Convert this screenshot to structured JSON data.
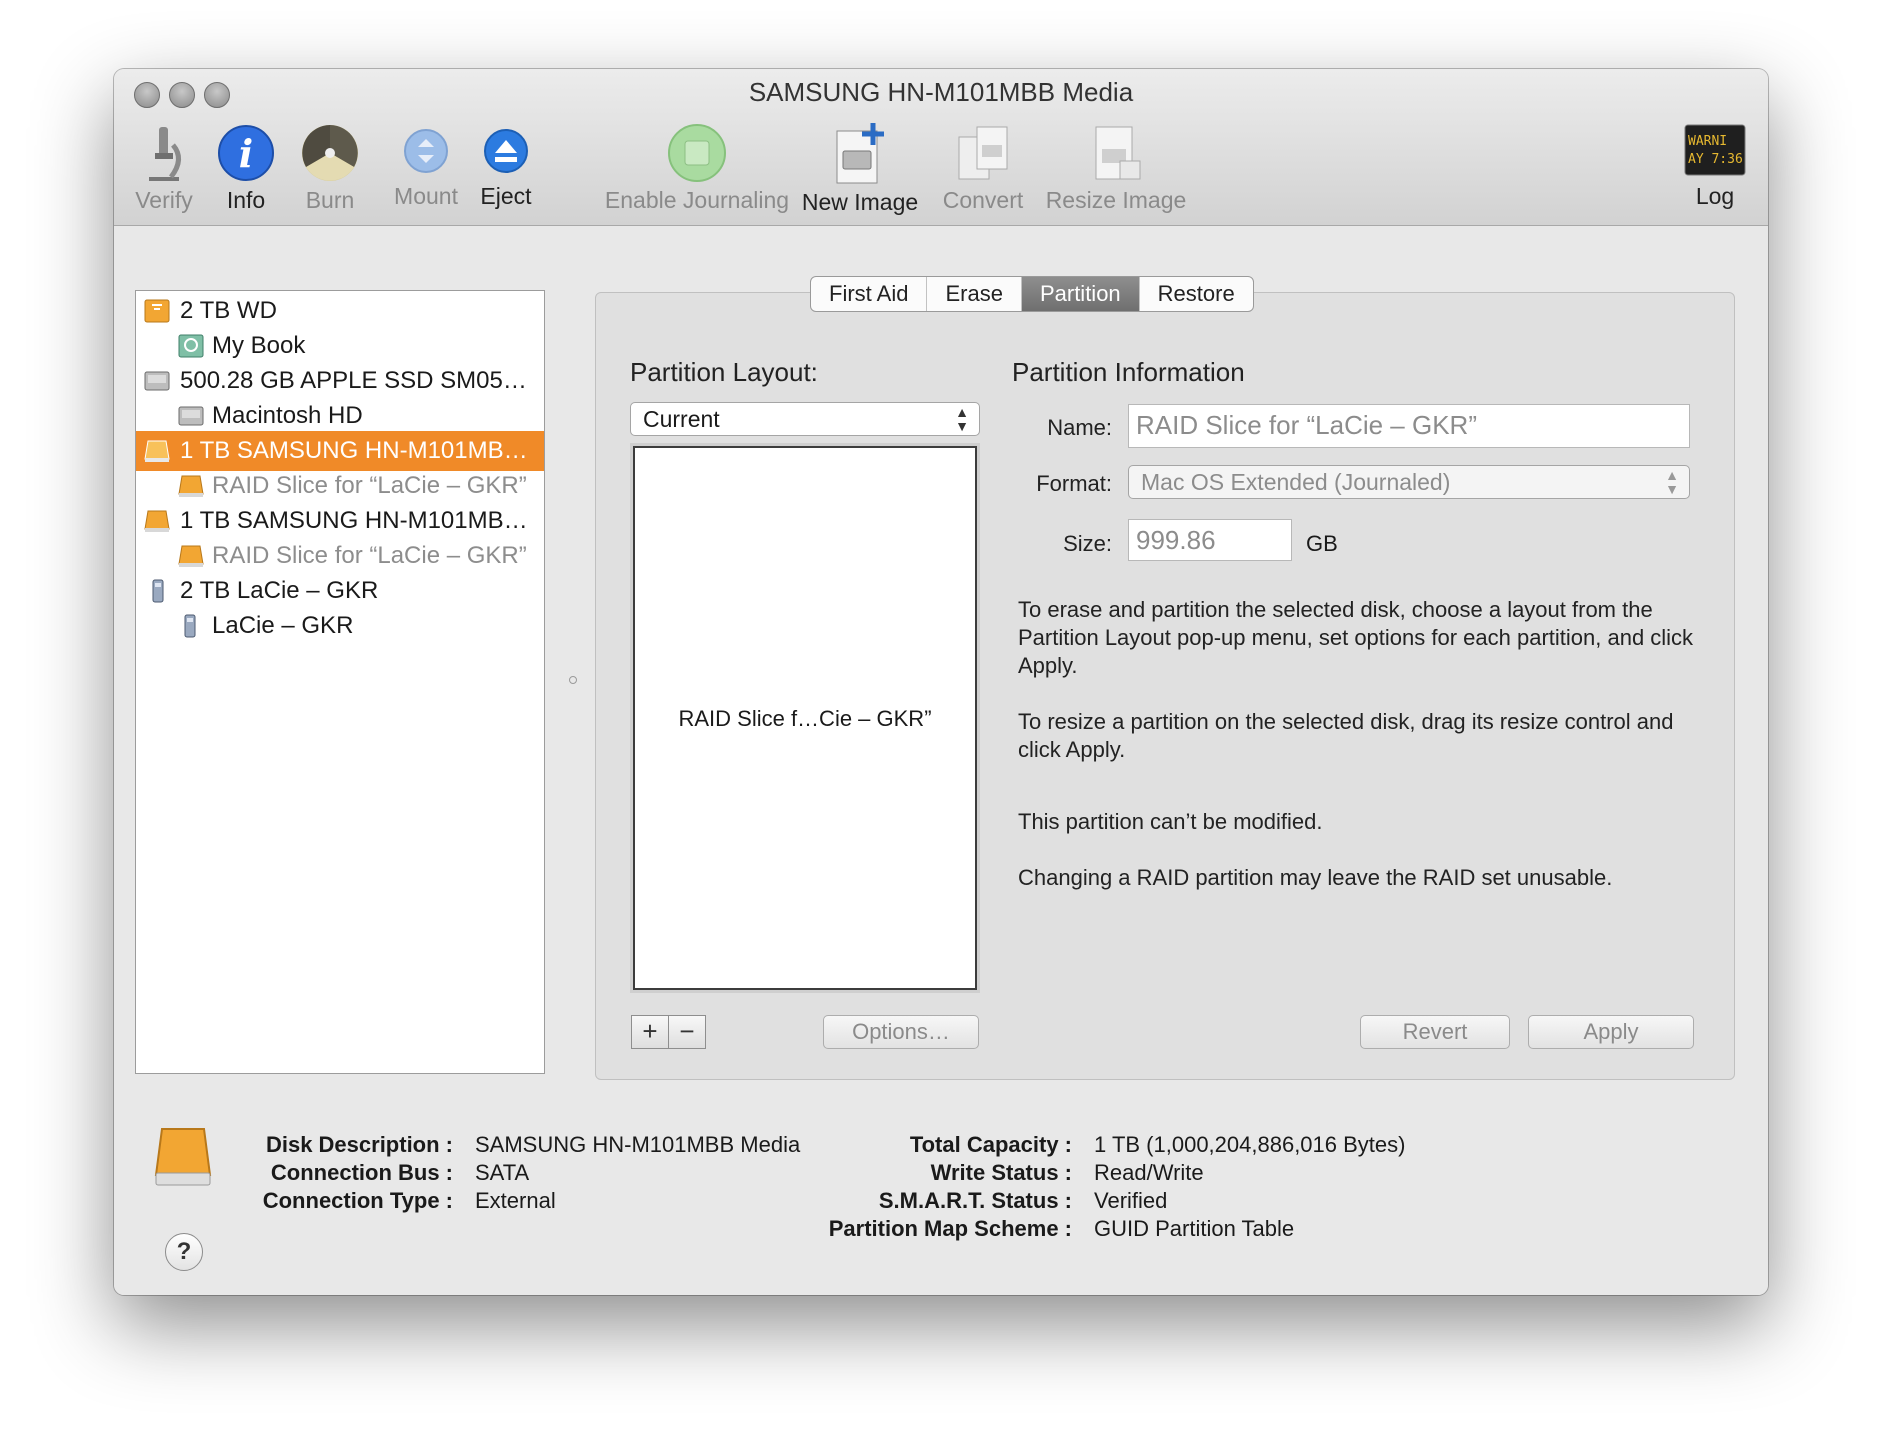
{
  "window": {
    "title": "SAMSUNG HN-M101MBB Media"
  },
  "toolbar": {
    "verify": "Verify",
    "info": "Info",
    "burn": "Burn",
    "mount": "Mount",
    "eject": "Eject",
    "enable_journaling": "Enable Journaling",
    "new_image": "New Image",
    "convert": "Convert",
    "resize_image": "Resize Image",
    "log": "Log",
    "log_icon_text": [
      "WARNI",
      "AY 7:36"
    ]
  },
  "sidebar": {
    "items": [
      {
        "label": "2 TB WD"
      },
      {
        "label": "My Book"
      },
      {
        "label": "500.28 GB APPLE SSD SM05…"
      },
      {
        "label": "Macintosh HD"
      },
      {
        "label": "1 TB SAMSUNG HN-M101MB…"
      },
      {
        "label": "RAID Slice for “LaCie – GKR”"
      },
      {
        "label": "1 TB SAMSUNG HN-M101MB…"
      },
      {
        "label": "RAID Slice for “LaCie – GKR”"
      },
      {
        "label": "2 TB LaCie – GKR"
      },
      {
        "label": "LaCie – GKR"
      }
    ],
    "selected_index": 4
  },
  "tabs": [
    "First Aid",
    "Erase",
    "Partition",
    "Restore"
  ],
  "partition": {
    "layout_label": "Partition Layout:",
    "layout_value": "Current",
    "map_label": "RAID Slice f…Cie – GKR”",
    "info_heading": "Partition Information",
    "name_label": "Name:",
    "name_value": "RAID Slice for “LaCie – GKR”",
    "format_label": "Format:",
    "format_value": "Mac OS Extended (Journaled)",
    "size_label": "Size:",
    "size_value": "999.86",
    "size_unit": "GB",
    "help1": "To erase and partition the selected disk, choose a layout from the Partition Layout pop-up menu, set options for each partition, and click Apply.",
    "help2": "To resize a partition on the selected disk, drag its resize control and click Apply.",
    "msg1": "This partition can’t be modified.",
    "msg2": "Changing a RAID partition may leave the RAID set unusable.",
    "add": "+",
    "remove": "−",
    "options_button": "Options…",
    "revert_button": "Revert",
    "apply_button": "Apply"
  },
  "disk_info": {
    "description_label": "Disk Description :",
    "description_value": "SAMSUNG HN-M101MBB Media",
    "bus_label": "Connection Bus :",
    "bus_value": "SATA",
    "type_label": "Connection Type :",
    "type_value": "External",
    "capacity_label": "Total Capacity :",
    "capacity_value": "1 TB (1,000,204,886,016 Bytes)",
    "write_label": "Write Status :",
    "write_value": "Read/Write",
    "smart_label": "S.M.A.R.T. Status :",
    "smart_value": "Verified",
    "scheme_label": "Partition Map Scheme :",
    "scheme_value": "GUID Partition Table"
  },
  "help_button": "?",
  "colors": {
    "selection": "#f08a28",
    "info_blue": "#2f6fe0",
    "eject_blue": "#2c7be0",
    "disk_orange": "#f2a633"
  }
}
